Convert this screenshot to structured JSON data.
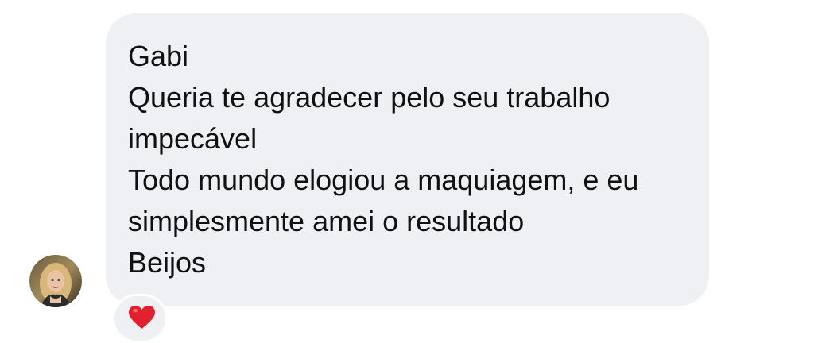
{
  "message": {
    "lines": [
      "Gabi",
      "Queria te agradecer pelo seu trabalho impecável",
      "Todo mundo elogiou a maquiagem, e eu simplesmente amei o resultado",
      "Beijos"
    ]
  },
  "reaction": {
    "icon": "red-heart-icon",
    "color": "#e3202e"
  },
  "avatar": {
    "icon": "contact-avatar-photo"
  },
  "colors": {
    "bubble": "#eff0f4",
    "text": "#111111",
    "background": "#ffffff"
  }
}
